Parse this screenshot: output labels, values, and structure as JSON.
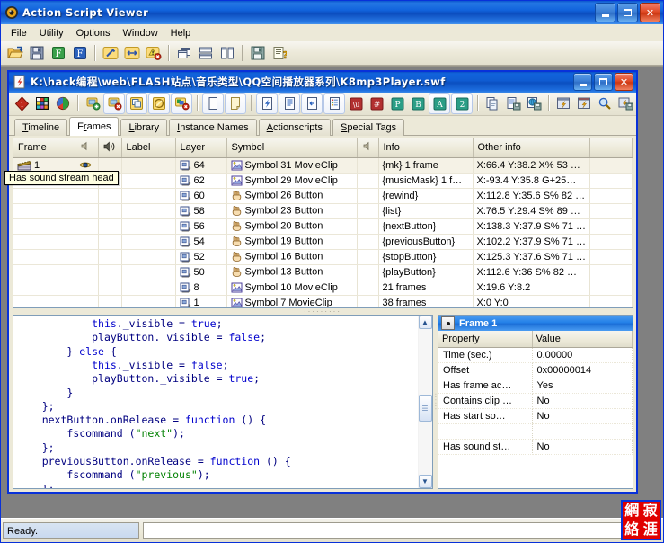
{
  "app": {
    "title": "Action Script Viewer",
    "title_icon": "asv-target-icon",
    "menu": [
      "File",
      "Utility",
      "Options",
      "Window",
      "Help"
    ],
    "window_buttons": {
      "minimize": "_",
      "maximize": "□",
      "close": "×"
    },
    "toolbar": [
      {
        "name": "open-file-button",
        "icon": "folder-open-icon"
      },
      {
        "name": "save-button",
        "icon": "floppy-disk-icon"
      },
      {
        "name": "flash-green-button",
        "icon": "f-green-icon",
        "label": "F"
      },
      {
        "name": "flash-blue-button",
        "icon": "f-blue-icon",
        "label": "F"
      },
      {
        "name": "tools-button",
        "icon": "wrench-icon"
      },
      {
        "name": "resize-button",
        "icon": "left-right-arrow-icon"
      },
      {
        "name": "delete-warning-button",
        "icon": "warning-delete-icon"
      },
      {
        "name": "cascade-windows-button",
        "icon": "cascade-icon"
      },
      {
        "name": "tile-horizontal-button",
        "icon": "tile-horizontal-icon"
      },
      {
        "name": "tile-vertical-button",
        "icon": "tile-vertical-icon"
      },
      {
        "name": "save-all-button",
        "icon": "save-all-icon"
      },
      {
        "name": "help-button",
        "icon": "help-document-icon"
      }
    ]
  },
  "mdi": {
    "title": "K:\\hack编程\\web\\FLASH站点\\音乐类型\\QQ空间播放器系列\\K8mp3Player.swf",
    "title_icon": "swf-document-icon",
    "toolbar": [
      {
        "name": "info-diamond-button",
        "icon": "red-diamond-info-icon"
      },
      {
        "name": "color-palette-button",
        "icon": "color-grid-icon"
      },
      {
        "name": "gradient-sphere-button",
        "icon": "colored-sphere-icon"
      },
      {
        "name": "export-add-button",
        "icon": "export-plus-icon"
      },
      {
        "name": "export-remove-button",
        "icon": "export-minus-icon"
      },
      {
        "name": "duplicate-frame-button",
        "icon": "duplicate-frame-icon"
      },
      {
        "name": "preview-circle-button",
        "icon": "yellow-circle-icon"
      },
      {
        "name": "delete-object-button",
        "icon": "delete-object-icon"
      },
      {
        "name": "page-plain-button",
        "icon": "page-plain-icon"
      },
      {
        "name": "page-note-button",
        "icon": "page-note-icon"
      },
      {
        "name": "compile-script-button",
        "icon": "lightning-page-icon"
      },
      {
        "name": "list-lines-button",
        "icon": "page-lines-icon"
      },
      {
        "name": "import-page-button",
        "icon": "page-import-icon"
      },
      {
        "name": "colored-list-button",
        "icon": "page-colorlist-icon"
      },
      {
        "name": "word-export-button",
        "icon": "w-red-icon",
        "label": "\\u"
      },
      {
        "name": "hash-export-button",
        "icon": "hash-red-icon",
        "label": "#"
      },
      {
        "name": "p-export-button",
        "icon": "p-green-icon",
        "label": "P"
      },
      {
        "name": "b-export-button",
        "icon": "b-green-icon",
        "label": "B"
      },
      {
        "name": "a-export-button",
        "icon": "a-green-icon",
        "label": "A"
      },
      {
        "name": "two-export-button",
        "icon": "two-green-icon",
        "label": "2"
      },
      {
        "name": "copy-button",
        "icon": "copy-pages-icon"
      },
      {
        "name": "save-page-button",
        "icon": "page-save-icon"
      },
      {
        "name": "export-web-button",
        "icon": "globe-save-icon"
      },
      {
        "name": "open-swf-button",
        "icon": "swf-open-icon"
      },
      {
        "name": "close-swf-button",
        "icon": "swf-close-icon"
      },
      {
        "name": "search-button",
        "icon": "magnifier-icon"
      },
      {
        "name": "swf-save-button",
        "icon": "swf-save-icon"
      }
    ],
    "tabs": [
      {
        "label": "Timeline",
        "accel": "T",
        "active": false
      },
      {
        "label": "Frames",
        "accel": "r",
        "active": true
      },
      {
        "label": "Library",
        "accel": "L",
        "active": false
      },
      {
        "label": "Instance Names",
        "accel": "I",
        "active": false
      },
      {
        "label": "Actionscripts",
        "accel": "A",
        "active": false
      },
      {
        "label": "Special Tags",
        "accel": "S",
        "active": false
      }
    ],
    "grid": {
      "columns": [
        "Frame",
        "",
        "",
        "Label",
        "Layer",
        "Symbol",
        "",
        "Info",
        "Other info",
        ""
      ],
      "column_icons": [
        "",
        "speaker-small-icon",
        "speaker-wave-icon",
        "",
        "",
        "",
        "speaker-small-icon",
        "",
        "",
        ""
      ],
      "rows": [
        {
          "frame": "1",
          "frame_icon": "clapperboard-icon",
          "eye_icon": "eye-icon",
          "label": "",
          "layer": "64",
          "layer_icon": "layer-icon",
          "symbol": "Symbol 31 MovieClip",
          "symbol_icon": "movieclip-icon",
          "info": "{mk} 1 frame",
          "other": "X:66.4 Y:38.2   X% 53   …"
        },
        {
          "frame": "",
          "frame_icon": "",
          "eye_icon": "",
          "label": "",
          "layer": "62",
          "layer_icon": "layer-icon",
          "symbol": "Symbol 29 MovieClip",
          "symbol_icon": "movieclip-icon",
          "info": "{musicMask} 1 f…",
          "other": "X:-93.4 Y:35.8      G+25…"
        },
        {
          "frame": "",
          "frame_icon": "",
          "eye_icon": "",
          "label": "",
          "layer": "60",
          "layer_icon": "layer-icon",
          "symbol": "Symbol 26 Button",
          "symbol_icon": "button-icon",
          "info": "{rewind}",
          "other": "X:112.8 Y:35.6   S% 82 …"
        },
        {
          "frame": "",
          "frame_icon": "",
          "eye_icon": "",
          "label": "",
          "layer": "58",
          "layer_icon": "layer-icon",
          "symbol": "Symbol 23 Button",
          "symbol_icon": "button-icon",
          "info": "{list}",
          "other": "X:76.5 Y:29.4   S% 89   …"
        },
        {
          "frame": "",
          "frame_icon": "",
          "eye_icon": "",
          "label": "",
          "layer": "56",
          "layer_icon": "layer-icon",
          "symbol": "Symbol 20 Button",
          "symbol_icon": "button-icon",
          "info": "{nextButton}",
          "other": "X:138.3 Y:37.9   S% 71 …"
        },
        {
          "frame": "",
          "frame_icon": "",
          "eye_icon": "",
          "label": "",
          "layer": "54",
          "layer_icon": "layer-icon",
          "symbol": "Symbol 19 Button",
          "symbol_icon": "button-icon",
          "info": "{previousButton}",
          "other": "X:102.2 Y:37.9   S% 71 …"
        },
        {
          "frame": "",
          "frame_icon": "",
          "eye_icon": "",
          "label": "",
          "layer": "52",
          "layer_icon": "layer-icon",
          "symbol": "Symbol 16 Button",
          "symbol_icon": "button-icon",
          "info": "{stopButton}",
          "other": "X:125.3 Y:37.6   S% 71 …"
        },
        {
          "frame": "",
          "frame_icon": "",
          "eye_icon": "",
          "label": "",
          "layer": "50",
          "layer_icon": "layer-icon",
          "symbol": "Symbol 13 Button",
          "symbol_icon": "button-icon",
          "info": "{playButton}",
          "other": "X:112.6 Y:36   S% 82   …"
        },
        {
          "frame": "",
          "frame_icon": "",
          "eye_icon": "",
          "label": "",
          "layer": "8",
          "layer_icon": "layer-icon",
          "symbol": "Symbol 10 MovieClip",
          "symbol_icon": "movieclip-icon",
          "info": "21 frames",
          "other": "X:19.6 Y:8.2"
        },
        {
          "frame": "",
          "frame_icon": "",
          "eye_icon": "",
          "label": "",
          "layer": "1",
          "layer_icon": "layer-icon",
          "symbol": "Symbol 7 MovieClip",
          "symbol_icon": "movieclip-icon",
          "info": "38 frames",
          "other": "X:0 Y:0"
        }
      ]
    },
    "code": "            this._visible = true;\n            playButton._visible = false;\n        } else {\n            this._visible = false;\n            playButton._visible = true;\n        }\n    };\n    nextButton.onRelease = function () {\n        fscommand (\"next\");\n    };\n    previousButton.onRelease = function () {\n        fscommand (\"previous\");\n    };",
    "properties": {
      "header": "Frame 1",
      "header_icon": "frame-properties-icon",
      "columns": [
        "Property",
        "Value"
      ],
      "rows": [
        {
          "name": "Time (sec.)",
          "value": "0.00000"
        },
        {
          "name": "Offset",
          "value": "0x00000014"
        },
        {
          "name": "Has frame ac…",
          "value": "Yes"
        },
        {
          "name": "Contains clip …",
          "value": "No"
        },
        {
          "name": "Has start so…",
          "value": "No"
        },
        {
          "name": "",
          "value": ""
        },
        {
          "name": "Has sound st…",
          "value": "No"
        }
      ],
      "tooltip": "Has sound stream head"
    }
  },
  "statusbar": {
    "left": "Ready.",
    "right": ""
  },
  "watermark": {
    "chars": [
      "網",
      "寂",
      "絡",
      "涯"
    ],
    "color": "#e00000"
  },
  "colors": {
    "titlebar_blue": "#0a50c8",
    "window_border": "#0831d9",
    "face": "#ece9d8",
    "client": "#808080",
    "code_keyword": "#0000cd",
    "code_string": "#008000",
    "code_default": "#000080",
    "tooltip_bg": "#ffffe1"
  }
}
